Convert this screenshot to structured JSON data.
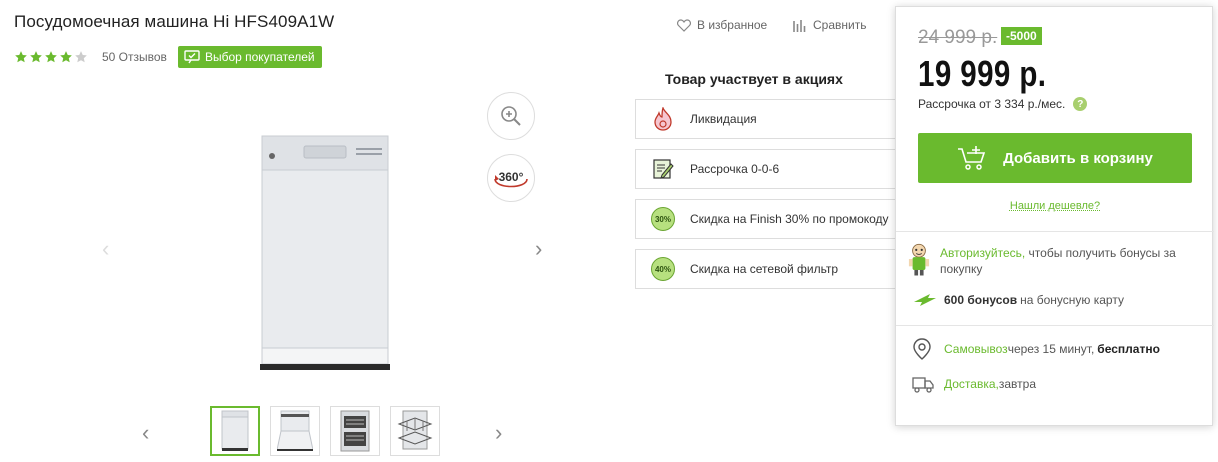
{
  "product": {
    "title": "Посудомоечная машина Hi HFS409A1W",
    "rating_stars": 4,
    "rating_max": 5,
    "reviews": "50 Отзывов",
    "choice_badge": "Выбор покупателей"
  },
  "actions": {
    "favorite": "В избранное",
    "compare": "Сравнить"
  },
  "promotions": {
    "title": "Товар участвует в акциях",
    "items": [
      {
        "label": "Ликвидация",
        "icon": "fire-icon"
      },
      {
        "label": "Рассрочка 0-0-6",
        "icon": "document-pen-icon"
      },
      {
        "label": "Скидка на Finish 30% по промокоду",
        "icon": "discount-icon",
        "badge": "30%"
      },
      {
        "label": "Скидка на сетевой фильтр",
        "icon": "discount-icon",
        "badge": "40%"
      }
    ]
  },
  "gallery": {
    "view360_label": "360°",
    "thumbnails": [
      "front-closed",
      "front-open",
      "interior",
      "racks-out"
    ],
    "active_thumbnail": 0
  },
  "buy": {
    "old_price": "24 999 р.",
    "discount": "-5000",
    "price": "19 999 р.",
    "installment": "Рассрочка от 3 334 р./мес.",
    "help": "?",
    "add_to_cart": "Добавить в корзину",
    "cheaper": "Нашли дешевле?",
    "auth_link": "Авторизуйтесь,",
    "auth_text": " чтобы получить бонусы за покупку",
    "bonus_amount": "600 бонусов",
    "bonus_text": "на бонусную карту",
    "pickup_link": "Самовывоз",
    "pickup_text": " через 15 минут,",
    "pickup_free": "бесплатно",
    "delivery_link": "Доставка,",
    "delivery_text": " завтра"
  },
  "colors": {
    "accent": "#6aba2e",
    "border": "#dddddd"
  }
}
